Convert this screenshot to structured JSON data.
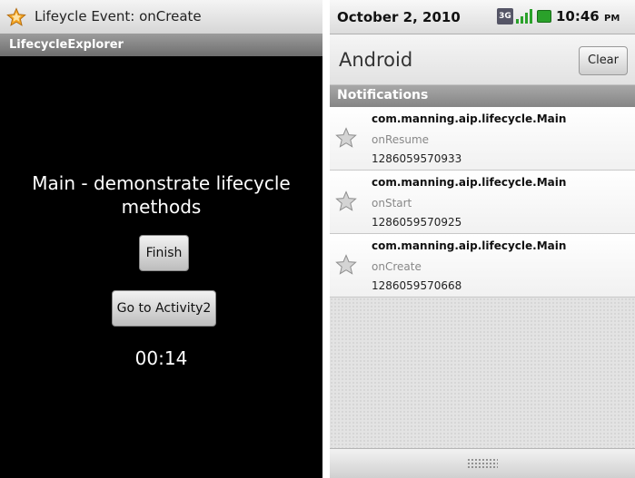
{
  "left_screen": {
    "status_title": "Lifeycle Event: onCreate",
    "app_title": "LifecycleExplorer",
    "main_text": "Main - demonstrate lifecycle methods",
    "finish_label": "Finish",
    "activity2_label": "Go to Activity2",
    "timer": "00:14"
  },
  "right_screen": {
    "status": {
      "date": "October 2, 2010",
      "network_badge": "3G",
      "time": "10:46",
      "ampm": "PM",
      "icons": [
        "3g-icon",
        "signal-icon",
        "battery-icon"
      ]
    },
    "header": {
      "title": "Android",
      "clear_label": "Clear"
    },
    "notifications_label": "Notifications",
    "notifications": [
      {
        "package": "com.manning.aip.lifecycle.Main",
        "event": "onResume",
        "timestamp": "1286059570933"
      },
      {
        "package": "com.manning.aip.lifecycle.Main",
        "event": "onStart",
        "timestamp": "1286059570925"
      },
      {
        "package": "com.manning.aip.lifecycle.Main",
        "event": "onCreate",
        "timestamp": "1286059570668"
      }
    ]
  },
  "colors": {
    "star_fill": "#f5a623",
    "notif_star": "#c8c8c8",
    "battery": "#2aa12a"
  }
}
